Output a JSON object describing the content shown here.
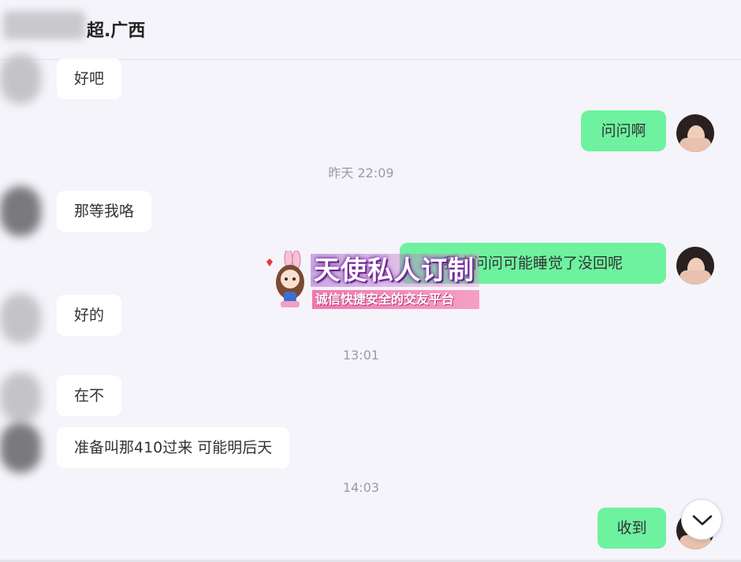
{
  "header": {
    "title": "超.广西"
  },
  "messages": [
    {
      "side": "left",
      "text": "好吧"
    },
    {
      "side": "right",
      "text": "问问啊"
    },
    {
      "side": "left",
      "text": "那等我咯"
    },
    {
      "side": "right",
      "text": "我去问问可能睡觉了没回呢"
    },
    {
      "side": "left",
      "text": "好的"
    },
    {
      "side": "left",
      "text": "在不"
    },
    {
      "side": "left",
      "text": "准备叫那410过来 可能明后天"
    },
    {
      "side": "right",
      "text": "收到"
    }
  ],
  "timestamps": [
    "昨天 22:09",
    "13:01",
    "14:03"
  ],
  "watermark": {
    "title": "天使私人订制",
    "subtitle": "诚信快捷安全的交友平台"
  },
  "icons": {
    "scroll_down": "chevron-down-icon"
  },
  "colors": {
    "right_bubble": "#6ef29f",
    "left_bubble": "#ffffff",
    "background": "#f5f4fa"
  }
}
